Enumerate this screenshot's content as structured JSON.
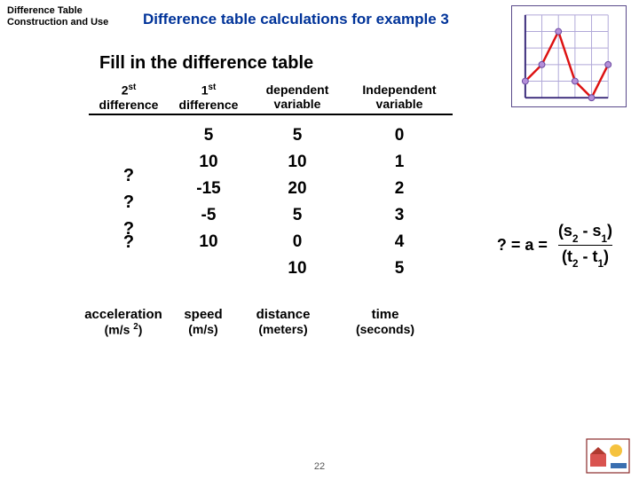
{
  "topic_label": "Difference Table Construction and Use",
  "page_title": "Difference table calculations for example 3",
  "subtitle": "Fill in the difference table",
  "columns": {
    "c1_line1": "2",
    "c1_sup": "st",
    "c1_line2": "difference",
    "c2_line1": "1",
    "c2_sup": "st",
    "c2_line2": "difference",
    "c3_line1": "dependent",
    "c3_line2": "variable",
    "c4_line1": "Independent",
    "c4_line2": "variable"
  },
  "rows": [
    {
      "c1": "",
      "c2": "5",
      "c3": "5",
      "c4": "0"
    },
    {
      "c1": "?",
      "c2": "10",
      "c3": "10",
      "c4": "1"
    },
    {
      "c1": "?",
      "c2": "-15",
      "c3": "20",
      "c4": "2"
    },
    {
      "c1": "?",
      "c2": "-5",
      "c3": "5",
      "c4": "3"
    },
    {
      "c1": "?",
      "c2": "10",
      "c3": "0",
      "c4": "4"
    },
    {
      "c1": "",
      "c2": "",
      "c3": "10",
      "c4": "5"
    }
  ],
  "units": {
    "u1_line1": "acceleration",
    "u1_line2": "(m/s ",
    "u1_sup": "2",
    "u1_line2b": ")",
    "u2_line1": "speed",
    "u2_line2": "(m/s)",
    "u3_line1": "distance",
    "u3_line2": "(meters)",
    "u4_line1": "time",
    "u4_line2": "(seconds)"
  },
  "formula": {
    "lhs": "? = a =",
    "num_a": "(s",
    "num_sub1": "2",
    "num_mid": " - s",
    "num_sub2": "1",
    "num_b": ")",
    "den_a": "(t",
    "den_sub1": "2",
    "den_mid": " - t",
    "den_sub2": "1",
    "den_b": ")"
  },
  "page_num": "22",
  "chart_data": {
    "type": "line",
    "x": [
      0,
      1,
      2,
      3,
      4,
      5
    ],
    "y": [
      5,
      10,
      20,
      5,
      0,
      10
    ],
    "xlim": [
      0,
      5
    ],
    "ylim": [
      0,
      25
    ],
    "grid": true
  }
}
